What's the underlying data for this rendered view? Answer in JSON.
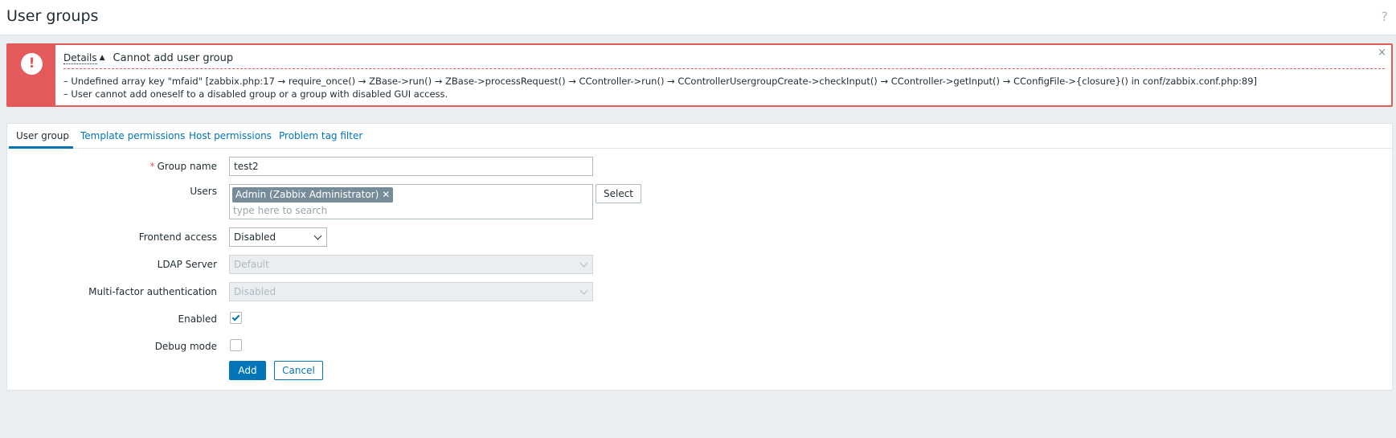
{
  "header": {
    "title": "User groups",
    "help_icon": "?"
  },
  "message": {
    "icon": "!",
    "details_label": "Details",
    "details_arrow": "▲",
    "title": "Cannot add user group",
    "details": [
      "– Undefined array key \"mfaid\" [zabbix.php:17 → require_once() → ZBase->run() → ZBase->processRequest() → CController->run() → CControllerUsergroupCreate->checkInput() → CController->getInput() → CConfigFile->{closure}() in conf/zabbix.conf.php:89]",
      "– User cannot add oneself to a disabled group or a group with disabled GUI access."
    ],
    "close_icon": "×"
  },
  "tabs": [
    {
      "label": "User group"
    },
    {
      "label": "Template permissions"
    },
    {
      "label": "Host permissions"
    },
    {
      "label": "Problem tag filter"
    }
  ],
  "form": {
    "group_name": {
      "required_mark": "*",
      "label": "Group name",
      "value": "test2"
    },
    "users": {
      "label": "Users",
      "chips": [
        "Admin (Zabbix Administrator)"
      ],
      "chip_remove": "✕",
      "placeholder": "type here to search",
      "select_label": "Select"
    },
    "frontend_access": {
      "label": "Frontend access",
      "value": "Disabled"
    },
    "ldap_server": {
      "label": "LDAP Server",
      "value": "Default"
    },
    "mfa": {
      "label": "Multi-factor authentication",
      "value": "Disabled"
    },
    "enabled": {
      "label": "Enabled",
      "checked": true
    },
    "debug_mode": {
      "label": "Debug mode",
      "checked": false
    },
    "add_label": "Add",
    "cancel_label": "Cancel"
  }
}
